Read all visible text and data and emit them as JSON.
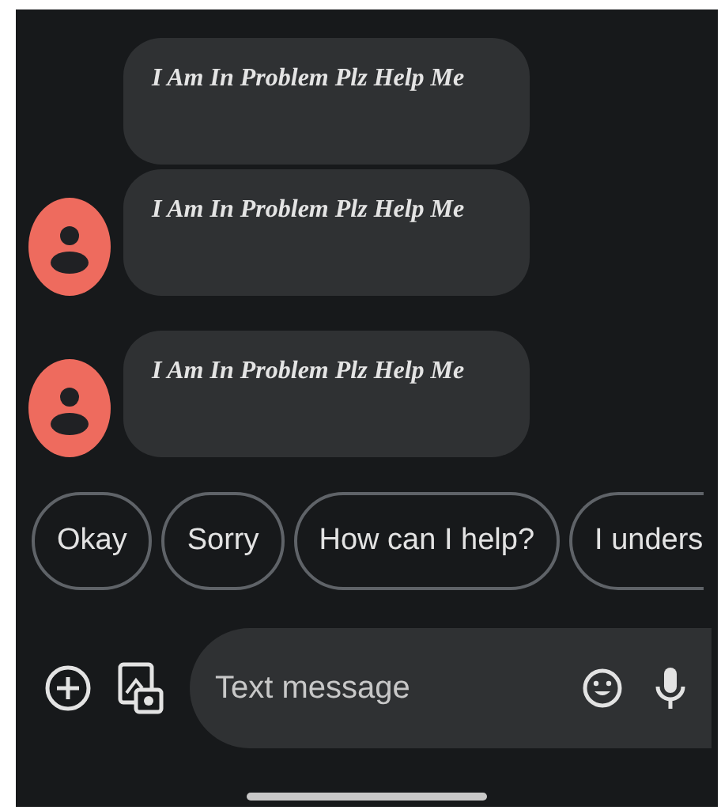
{
  "messages": [
    {
      "text": "I Am In Problem Plz Help Me",
      "avatar": false
    },
    {
      "text": "I Am In Problem Plz Help Me",
      "avatar": true
    },
    {
      "text": "I Am In Problem Plz Help Me",
      "avatar": true
    }
  ],
  "suggestions": [
    {
      "label": "Okay",
      "cut_off": false
    },
    {
      "label": "Sorry",
      "cut_off": false
    },
    {
      "label": "How can I help?",
      "cut_off": false
    },
    {
      "label": "I unders",
      "cut_off": true
    }
  ],
  "composer": {
    "placeholder": "Text message"
  }
}
